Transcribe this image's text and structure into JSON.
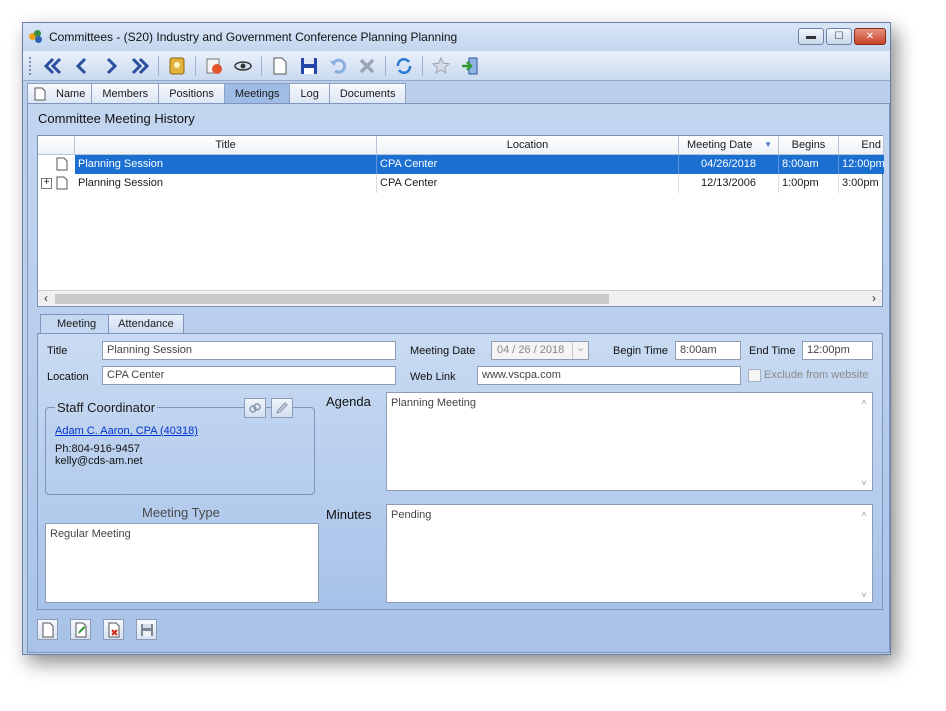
{
  "window": {
    "title": "Committees - (S20) Industry and Government Conference Planning Planning",
    "minimize_symbol": "▬",
    "maximize_symbol": "☐",
    "close_symbol": "✕"
  },
  "toolbar": {
    "buttons": [
      "first-record-icon",
      "previous-record-icon",
      "next-record-icon",
      "last-record-icon",
      "lookup-icon",
      "report-icon",
      "view-icon",
      "new-icon",
      "save-icon",
      "undo-icon",
      "delete-icon",
      "refresh-icon",
      "favorite-icon",
      "exit-icon"
    ]
  },
  "tabs": [
    "Name",
    "Members",
    "Positions",
    "Meetings",
    "Log",
    "Documents"
  ],
  "active_tab": "Meetings",
  "history": {
    "title": "Committee Meeting History",
    "columns": [
      "Title",
      "Location",
      "Meeting Date",
      "Begins",
      "End"
    ],
    "sort_arrow": "▼",
    "expand_symbol": "+",
    "rows": [
      {
        "title": "Planning Session",
        "location": "CPA Center",
        "date": "04/26/2018",
        "begins": "8:00am",
        "end": "12:00pm",
        "selected": true
      },
      {
        "title": "Planning Session",
        "location": "CPA Center",
        "date": "12/13/2006",
        "begins": "1:00pm",
        "end": "3:00pm",
        "selected": false
      }
    ],
    "scroll_left": "‹",
    "scroll_right": "›"
  },
  "subtabs": [
    "Meeting",
    "Attendance"
  ],
  "meeting": {
    "title_label": "Title",
    "title_value": "Planning Session",
    "location_label": "Location",
    "location_value": "CPA Center",
    "date_label": "Meeting Date",
    "date_value": "04 / 26 / 2018",
    "date_dropdown": "⌄",
    "begin_label": "Begin Time",
    "begin_value": "8:00am",
    "end_label": "End Time",
    "end_value": "12:00pm",
    "weblink_label": "Web Link",
    "weblink_value": "www.vscpa.com",
    "exclude_label": "Exclude from website",
    "coordinator_title": "Staff Coordinator",
    "coordinator_name": "Adam C. Aaron, CPA (40318)",
    "coordinator_phone": "Ph:804-916-9457",
    "coordinator_email": "kelly@cds-am.net",
    "agenda_label": "Agenda",
    "agenda_value": "Planning Meeting",
    "meeting_type_label": "Meeting Type",
    "meeting_type_value": "Regular Meeting",
    "minutes_label": "Minutes",
    "minutes_value": "Pending",
    "scroll_up": "˄",
    "scroll_down": "˅"
  },
  "bottom_buttons": [
    "new-meeting-icon",
    "edit-meeting-icon",
    "delete-meeting-icon",
    "save-meeting-icon"
  ]
}
